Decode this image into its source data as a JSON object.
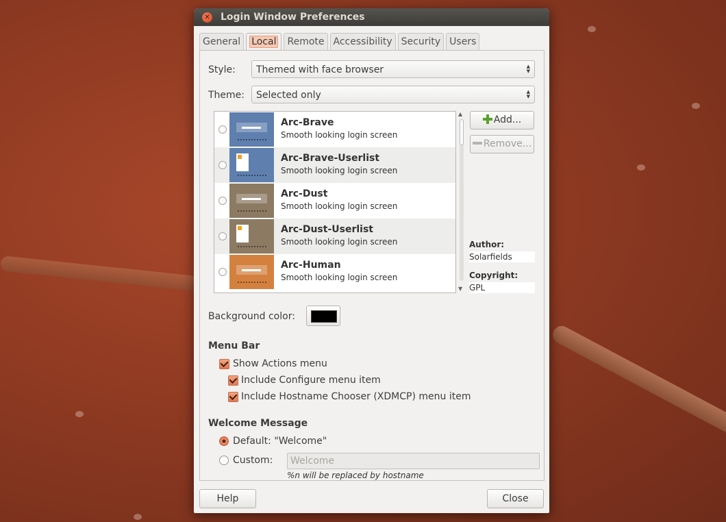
{
  "window": {
    "title": "Login Window Preferences"
  },
  "tabs": [
    "General",
    "Local",
    "Remote",
    "Accessibility",
    "Security",
    "Users"
  ],
  "style": {
    "label": "Style:",
    "value": "Themed with face browser"
  },
  "theme": {
    "label": "Theme:",
    "value": "Selected only"
  },
  "themes": [
    {
      "name": "Arc-Brave",
      "desc": "Smooth looking login screen",
      "color": "#5f7fae",
      "userlist": false
    },
    {
      "name": "Arc-Brave-Userlist",
      "desc": "Smooth looking login screen",
      "color": "#5f7fae",
      "userlist": true
    },
    {
      "name": "Arc-Dust",
      "desc": "Smooth looking login screen",
      "color": "#8c7a63",
      "userlist": false
    },
    {
      "name": "Arc-Dust-Userlist",
      "desc": "Smooth looking login screen",
      "color": "#8c7a63",
      "userlist": true
    },
    {
      "name": "Arc-Human",
      "desc": "Smooth looking login screen",
      "color": "#d4813f",
      "userlist": false
    }
  ],
  "buttons": {
    "add": "Add...",
    "remove": "Remove...",
    "help": "Help",
    "close": "Close"
  },
  "meta": {
    "author_label": "Author:",
    "author": "Solarfields",
    "copyright_label": "Copyright:",
    "copyright": "GPL"
  },
  "background": {
    "label": "Background color:",
    "color": "#000000"
  },
  "menubar": {
    "title": "Menu Bar",
    "show_actions": "Show Actions menu",
    "include_configure": "Include Configure menu item",
    "include_hostname": "Include Hostname Chooser (XDMCP) menu item"
  },
  "welcome": {
    "title": "Welcome Message",
    "default": "Default: \"Welcome\"",
    "custom": "Custom:",
    "custom_placeholder": "Welcome",
    "hint": "%n will be replaced by hostname"
  }
}
